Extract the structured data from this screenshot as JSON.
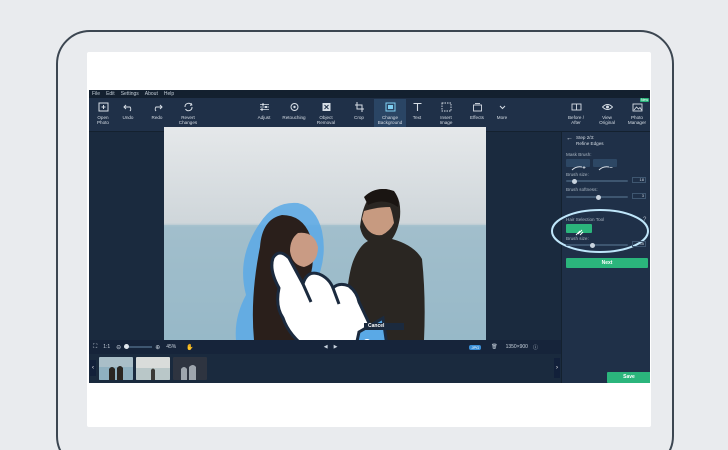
{
  "menu": [
    "File",
    "Edit",
    "Settings",
    "About",
    "Help"
  ],
  "toolbar_left": [
    {
      "label": "Open\nPhoto",
      "icon": "open-photo-icon"
    },
    {
      "label": "Undo",
      "icon": "undo-icon"
    },
    {
      "label": "Redo",
      "icon": "redo-icon"
    },
    {
      "label": "Revert\nChanges",
      "icon": "revert-icon"
    }
  ],
  "toolbar_tools": [
    {
      "label": "Adjust",
      "icon": "adjust-icon"
    },
    {
      "label": "Retouching",
      "icon": "retouching-icon"
    },
    {
      "label": "Object\nRemoval",
      "icon": "object-removal-icon"
    },
    {
      "label": "Crop",
      "icon": "crop-icon"
    },
    {
      "label": "Change\nBackground",
      "icon": "change-background-icon"
    },
    {
      "label": "Text",
      "icon": "text-icon"
    },
    {
      "label": "Insert\nImage",
      "icon": "insert-image-icon"
    },
    {
      "label": "Effects",
      "icon": "effects-icon"
    },
    {
      "label": "More",
      "icon": "more-icon"
    }
  ],
  "toolbar_right": [
    {
      "label": "Before /\nAfter",
      "icon": "before-after-icon"
    },
    {
      "label": "View\nOriginal",
      "icon": "eye-icon"
    },
    {
      "label": "Photo\nManager",
      "icon": "photo-manager-icon",
      "badge": "New"
    }
  ],
  "panel": {
    "step_title": "Step 2/3:",
    "step_subtitle": "Refine Edges",
    "mask_brush_label": "Mask Brush:",
    "brush_size_label": "Brush size:",
    "brush_size_value": "18",
    "brush_softness_label": "Brush softness:",
    "brush_softness_value": "3",
    "hair_tool_label": "Hair Selection Tool",
    "hair_help": "?",
    "hair_brush_size_label": "Brush size:",
    "hair_brush_size_value": "45",
    "next_label": "Next",
    "save_label": "Save"
  },
  "controls": {
    "fit_label": "1:1",
    "zoom_value": "45%",
    "play_prev": "◀",
    "play_next": "▶",
    "format_badge": "JPG",
    "dimensions": "1350×900"
  },
  "overlay": {
    "cancel_label": "Cancel"
  },
  "colors": {
    "app_bg": "#1c2b40",
    "accent_green": "#2bb57c",
    "mask_blue": "#5aa9e6"
  }
}
